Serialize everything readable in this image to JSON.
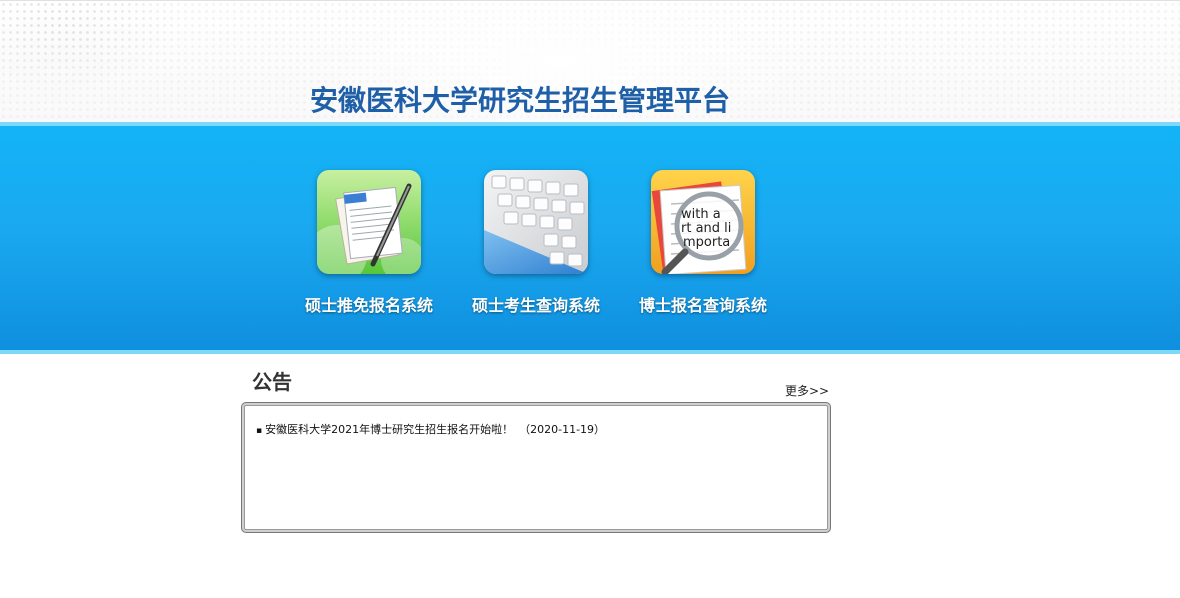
{
  "header": {
    "title": "安徽医科大学研究生招生管理平台"
  },
  "systems": [
    {
      "label": "硕士推免报名系统",
      "icon": "document-pen-icon"
    },
    {
      "label": "硕士考生查询系统",
      "icon": "keyboard-icon"
    },
    {
      "label": "博士报名查询系统",
      "icon": "magnifier-icon"
    }
  ],
  "notice": {
    "title": "公告",
    "more_label": "更多>>",
    "items": [
      {
        "bullet": "▪",
        "text": "安徽医科大学2021年博士研究生招生报名开始啦！",
        "date": "（2020-11-19）"
      }
    ]
  },
  "colors": {
    "title_blue": "#1e5fa8",
    "band_blue": "#1aa9f0",
    "band_edge": "#7ed8f7"
  }
}
